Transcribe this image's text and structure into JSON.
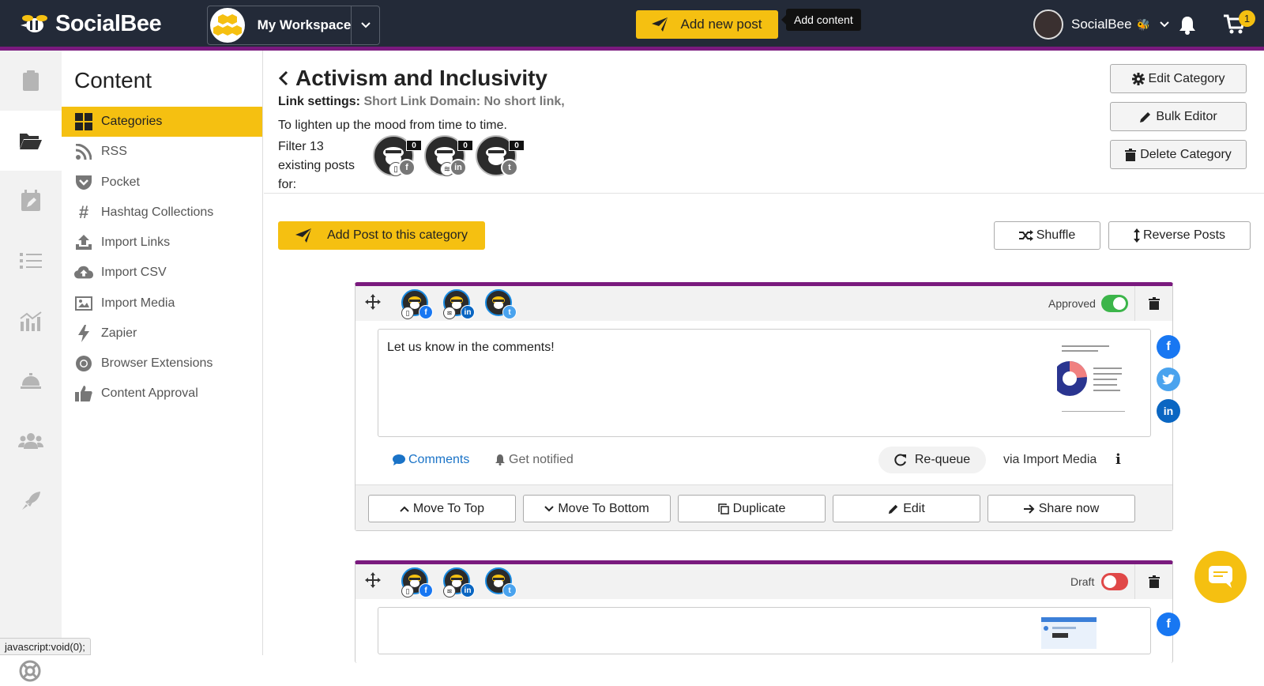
{
  "app": {
    "logo_text": "SocialBee"
  },
  "topbar": {
    "workspace": "My Workspace",
    "add_post_label": "Add new post",
    "tooltip": "Add content",
    "user_name": "SocialBee",
    "user_emoji": "🐝",
    "cart_count": "1"
  },
  "colors": {
    "accent": "#f5c011",
    "topbar": "#232a38",
    "category": "#7a1a7e",
    "facebook": "#1877f2",
    "twitter": "#4aa3ee",
    "linkedin": "#0a66c2",
    "approved": "#3cb54a",
    "draft": "#e04848"
  },
  "sidebar": {
    "title": "Content",
    "items": [
      {
        "label": "Categories",
        "icon": "grid-icon"
      },
      {
        "label": "RSS",
        "icon": "rss-icon"
      },
      {
        "label": "Pocket",
        "icon": "pocket-icon"
      },
      {
        "label": "Hashtag Collections",
        "icon": "hashtag-icon"
      },
      {
        "label": "Import Links",
        "icon": "upload-icon"
      },
      {
        "label": "Import CSV",
        "icon": "cloud-upload-icon"
      },
      {
        "label": "Import Media",
        "icon": "image-icon"
      },
      {
        "label": "Zapier",
        "icon": "bolt-icon"
      },
      {
        "label": "Browser Extensions",
        "icon": "chrome-icon"
      },
      {
        "label": "Content Approval",
        "icon": "thumbs-up-icon"
      }
    ]
  },
  "category": {
    "title": "Activism and Inclusivity",
    "link_settings_label": "Link settings:",
    "short_link_label": "Short Link Domain:",
    "short_link_value": "No short link,",
    "description": "To lighten up the mood from time to time.",
    "filter_text": "Filter 13 existing posts for:",
    "profiles": [
      {
        "count": "0",
        "network": "f"
      },
      {
        "count": "0",
        "network": "in"
      },
      {
        "count": "0",
        "network": "t"
      }
    ],
    "edit_label": "Edit Category",
    "bulk_label": "Bulk Editor",
    "delete_label": "Delete Category",
    "add_post_label": "Add Post to this category",
    "shuffle_label": "Shuffle",
    "reverse_label": "Reverse Posts"
  },
  "posts": [
    {
      "status": "Approved",
      "text": "Let us know in the comments!",
      "comments_label": "Comments",
      "notify_label": "Get notified",
      "requeue_label": "Re-queue",
      "via": "via Import Media",
      "actions": [
        "Move To Top",
        "Move To Bottom",
        "Duplicate",
        "Edit",
        "Share now"
      ]
    },
    {
      "status": "Draft"
    }
  ],
  "statusbar": "javascript:void(0);"
}
